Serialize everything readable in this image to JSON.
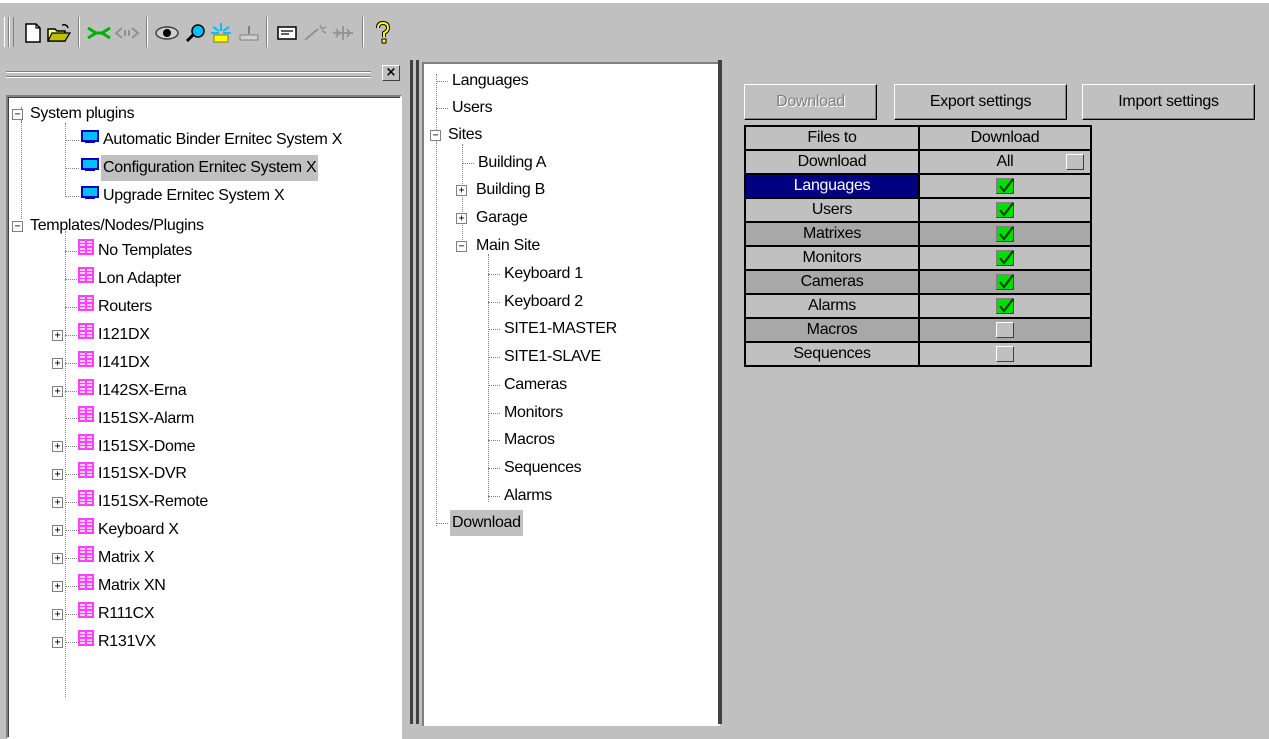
{
  "toolbar": {
    "icons": [
      "new-icon",
      "open-icon",
      "connect-icon",
      "disconnect-icon",
      "view-icon",
      "search-icon",
      "highlight-icon",
      "install-icon",
      "message-icon",
      "wizard-icon",
      "network-icon",
      "help-icon"
    ]
  },
  "left_tree": {
    "groups": [
      {
        "label": "System plugins",
        "items": [
          {
            "label": "Automatic Binder Ernitec System X"
          },
          {
            "label": "Configuration Ernitec System X",
            "selected": true
          },
          {
            "label": "Upgrade Ernitec System X"
          }
        ]
      },
      {
        "label": "Templates/Nodes/Plugins",
        "items": [
          {
            "label": "No Templates",
            "expandable": false
          },
          {
            "label": "Lon Adapter",
            "expandable": false
          },
          {
            "label": "Routers",
            "expandable": false
          },
          {
            "label": "I121DX",
            "expandable": true
          },
          {
            "label": "I141DX",
            "expandable": true
          },
          {
            "label": "I142SX-Erna",
            "expandable": true
          },
          {
            "label": "I151SX-Alarm",
            "expandable": false
          },
          {
            "label": "I151SX-Dome",
            "expandable": true
          },
          {
            "label": "I151SX-DVR",
            "expandable": true
          },
          {
            "label": "I151SX-Remote",
            "expandable": true
          },
          {
            "label": "Keyboard X",
            "expandable": true
          },
          {
            "label": "Matrix X",
            "expandable": true
          },
          {
            "label": "Matrix XN",
            "expandable": true
          },
          {
            "label": "R111CX",
            "expandable": true
          },
          {
            "label": "R131VX",
            "expandable": true
          }
        ]
      }
    ]
  },
  "mid_tree": {
    "languages": "Languages",
    "users": "Users",
    "sites": "Sites",
    "building_a": "Building A",
    "building_b": "Building B",
    "garage": "Garage",
    "main_site": "Main Site",
    "main_site_items": [
      "Keyboard 1",
      "Keyboard 2",
      "SITE1-MASTER",
      "SITE1-SLAVE",
      "Cameras",
      "Monitors",
      "Macros",
      "Sequences",
      "Alarms"
    ],
    "download": "Download"
  },
  "actions": {
    "download": "Download",
    "export": "Export settings",
    "import": "Import settings"
  },
  "grid": {
    "header_col1": "Files to",
    "header_col2": "Download",
    "subheader_col1": "Download",
    "subheader_col2": "All",
    "rows": [
      {
        "label": "Languages",
        "checked": true
      },
      {
        "label": "Users",
        "checked": true
      },
      {
        "label": "Matrixes",
        "checked": true
      },
      {
        "label": "Monitors",
        "checked": true
      },
      {
        "label": "Cameras",
        "checked": true
      },
      {
        "label": "Alarms",
        "checked": true
      },
      {
        "label": "Macros",
        "checked": false
      },
      {
        "label": "Sequences",
        "checked": false
      }
    ]
  },
  "colors": {
    "selection": "#000080",
    "check_on": "#00e000",
    "template_icon": "#ff40ff",
    "plugin_icon": "#0000c0"
  }
}
